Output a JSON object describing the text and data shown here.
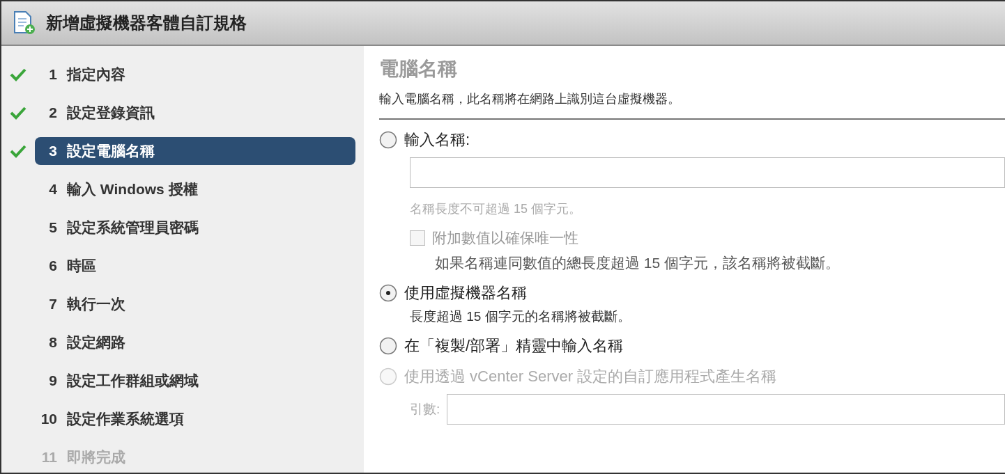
{
  "window": {
    "title": "新增虛擬機器客體自訂規格"
  },
  "steps": [
    {
      "number": "1",
      "label": "指定內容",
      "done": true,
      "selected": false,
      "disabled": false
    },
    {
      "number": "2",
      "label": "設定登錄資訊",
      "done": true,
      "selected": false,
      "disabled": false
    },
    {
      "number": "3",
      "label": "設定電腦名稱",
      "done": true,
      "selected": true,
      "disabled": false
    },
    {
      "number": "4",
      "label": "輸入 Windows 授權",
      "done": false,
      "selected": false,
      "disabled": false
    },
    {
      "number": "5",
      "label": "設定系統管理員密碼",
      "done": false,
      "selected": false,
      "disabled": false
    },
    {
      "number": "6",
      "label": "時區",
      "done": false,
      "selected": false,
      "disabled": false
    },
    {
      "number": "7",
      "label": "執行一次",
      "done": false,
      "selected": false,
      "disabled": false
    },
    {
      "number": "8",
      "label": "設定網路",
      "done": false,
      "selected": false,
      "disabled": false
    },
    {
      "number": "9",
      "label": "設定工作群組或網域",
      "done": false,
      "selected": false,
      "disabled": false
    },
    {
      "number": "10",
      "label": "設定作業系統選項",
      "done": false,
      "selected": false,
      "disabled": false
    },
    {
      "number": "11",
      "label": "即將完成",
      "done": false,
      "selected": false,
      "disabled": true
    }
  ],
  "page": {
    "heading": "電腦名稱",
    "description": "輸入電腦名稱，此名稱將在網路上識別這台虛擬機器。",
    "options": [
      {
        "kind": "name-entry",
        "label": "輸入名稱:",
        "selected": false,
        "disabled": false,
        "hint": "名稱長度不可超過 15 個字元。",
        "checkbox": {
          "label": "附加數值以確保唯一性",
          "checked": false,
          "disabled": true,
          "note": "如果名稱連同數值的總長度超過 15 個字元，該名稱將被截斷。"
        }
      },
      {
        "kind": "plain",
        "label": "使用虛擬機器名稱",
        "selected": true,
        "disabled": false,
        "note": "長度超過 15 個字元的名稱將被截斷。"
      },
      {
        "kind": "plain",
        "label": "在「複製/部署」精靈中輸入名稱",
        "selected": false,
        "disabled": false
      },
      {
        "kind": "argument",
        "label": "使用透過 vCenter Server 設定的自訂應用程式產生名稱",
        "selected": false,
        "disabled": true,
        "argument_label": "引數:"
      }
    ]
  }
}
